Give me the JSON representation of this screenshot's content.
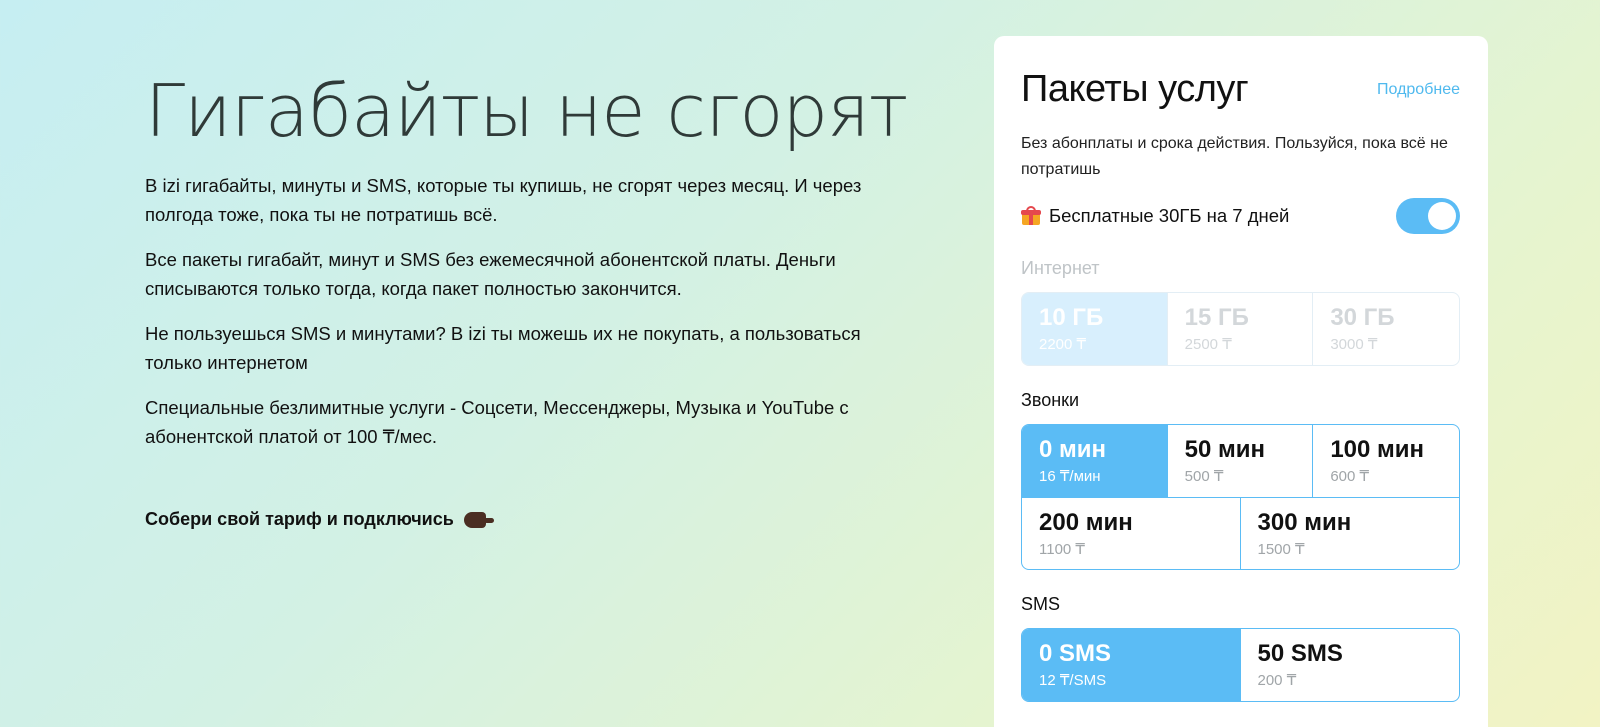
{
  "hero": {
    "title": "Гигабайты не сгорят",
    "paragraphs": [
      "В izi гигабайты, минуты и SMS, которые ты купишь, не сгорят через месяц. И через полгода тоже, пока ты не потратишь всё.",
      "Все пакеты гигабайт, минут и SMS без ежемесячной абонентской платы. Деньги списываются только тогда, когда пакет полностью закончится.",
      "Не пользуешься SMS и минутами? В izi ты можешь их не покупать, а пользоваться только интернетом",
      "Специальные безлимитные услуги - Соцсети, Мессенджеры, Музыка и YouTube с абонентской платой от 100 ₸/мес."
    ],
    "cta": "Собери свой тариф и подключись",
    "cta_icon": "pointing-hand-icon"
  },
  "card": {
    "title": "Пакеты услуг",
    "more_link": "Подробнее",
    "subtitle": "Без абонплаты и срока действия. Пользуйся, пока всё не потратишь",
    "promo": {
      "icon": "gift-icon",
      "text": "Бесплатные 30ГБ на 7 дней",
      "enabled": true
    },
    "internet": {
      "label": "Интернет",
      "disabled": true,
      "options": [
        {
          "name": "10 ГБ",
          "price": "2200 ₸",
          "selected": true
        },
        {
          "name": "15 ГБ",
          "price": "2500 ₸",
          "selected": false
        },
        {
          "name": "30 ГБ",
          "price": "3000 ₸",
          "selected": false
        }
      ]
    },
    "calls": {
      "label": "Звонки",
      "options": [
        {
          "name": "0 мин",
          "price": "16 ₸/мин",
          "selected": true
        },
        {
          "name": "50 мин",
          "price": "500 ₸",
          "selected": false
        },
        {
          "name": "100 мин",
          "price": "600 ₸",
          "selected": false
        },
        {
          "name": "200 мин",
          "price": "1100 ₸",
          "selected": false
        },
        {
          "name": "300 мин",
          "price": "1500 ₸",
          "selected": false
        }
      ]
    },
    "sms": {
      "label": "SMS",
      "options": [
        {
          "name": "0 SMS",
          "price": "12 ₸/SMS",
          "selected": true
        },
        {
          "name": "50 SMS",
          "price": "200 ₸",
          "selected": false
        }
      ]
    },
    "colors": {
      "accent": "#5bbcf5",
      "link": "#4fb9ee"
    }
  }
}
